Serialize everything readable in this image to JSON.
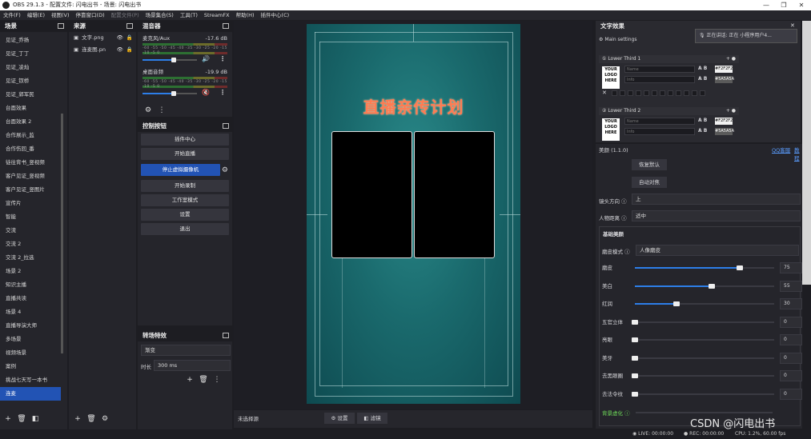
{
  "window": {
    "title": "OBS 29.1.3 - 配置文件: 闪电出书 - 场景: 闪电出书",
    "min": "—",
    "max": "❐",
    "close": "✕"
  },
  "menu": [
    "文件(F)",
    "编辑(E)",
    "视图(V)",
    "停靠窗口(D)",
    "配置文件(P)",
    "场景集合(S)",
    "工具(T)",
    "StreamFX",
    "帮助(H)",
    "插件中心(C)"
  ],
  "scenes": {
    "title": "场景",
    "items": [
      "见证_乔扬",
      "见证_丁丁",
      "见证_凌灿",
      "见证_钗桥",
      "见证_郭军民",
      "台面效果",
      "台面效果 2",
      "合作展示_监",
      "合作伤回_番",
      "徒往背书_竖视频",
      "客户见证_竖视频",
      "客户见证_竖图片",
      "宣传片",
      "智能",
      "交流",
      "交流 2",
      "交流 2_拉选",
      "场景 2",
      "知识主播",
      "直播共读",
      "场景 4",
      "直播导演大师",
      "多场景",
      "视频场景",
      "案例",
      "挑战七天写一本书",
      "连麦"
    ],
    "selected_index": 26
  },
  "sources": {
    "title": "来源",
    "items": [
      {
        "name": "文字.png",
        "icon": "image-icon"
      },
      {
        "name": "连麦图.pn",
        "icon": "image-icon"
      }
    ]
  },
  "mixer": {
    "title": "混音器",
    "channels": [
      {
        "name": "麦克风/Aux",
        "db": "-17.6 dB",
        "level": 0.3,
        "muted": false
      },
      {
        "name": "桌面音频",
        "db": "-19.9 dB",
        "level": 0.3,
        "muted": true
      }
    ],
    "ticks": "-60 -55 -50 -45 -40 -35 -30 -25 -20 -15 -10 -5 0"
  },
  "controls": {
    "title": "控制按钮",
    "buttons": [
      "插件中心",
      "开始直播",
      "停止虚拟摄像机",
      "开始录制",
      "工作室模式",
      "设置",
      "退出"
    ],
    "active_index": 2
  },
  "transitions": {
    "title": "转场特效",
    "type": "渐变",
    "duration_label": "时长",
    "duration": "300 ms"
  },
  "preview": {
    "overlay_title": "直播亲传计划",
    "bottom_label": "未选择源",
    "settings_btn": "设置",
    "filters_btn": "滤镜"
  },
  "text_effects": {
    "title": "文字效果",
    "main_settings": "Main settings",
    "lower_thirds": [
      {
        "label": "Lower Third 1",
        "name_ph": "Name",
        "info_ph": "Info",
        "color1": "#F2F2F2",
        "color2": "#5A5A5A"
      },
      {
        "label": "Lower Third 2",
        "name_ph": "Name",
        "info_ph": "Info",
        "color1": "#F2F2F2",
        "color2": "#5A5A5A"
      }
    ],
    "logo_text": "YOUR LOGO HERE"
  },
  "tooltip": {
    "speaking": "正在讲话:",
    "text": "正在 小程序用户4..."
  },
  "beauty": {
    "title": "美颜 (1.1.0)",
    "qq_link": "QQ客服",
    "about_link": "教程",
    "reset_btn": "恢复默认",
    "auto_btn": "自动对焦",
    "direction_label": "镜头方向",
    "direction_value": "上",
    "distance_label": "人物距离",
    "distance_value": "适中",
    "section": "基础美颜",
    "mode_label": "磨皮模式",
    "mode_value": "人像磨皮",
    "sliders": [
      {
        "label": "磨皮",
        "value": "75",
        "level": 0.75
      },
      {
        "label": "美白",
        "value": "55",
        "level": 0.55
      },
      {
        "label": "红润",
        "value": "30",
        "level": 0.3
      },
      {
        "label": "五官立体",
        "value": "0",
        "level": 0
      },
      {
        "label": "亮眼",
        "value": "0",
        "level": 0
      },
      {
        "label": "美牙",
        "value": "0",
        "level": 0
      },
      {
        "label": "去黑眼圈",
        "value": "0",
        "level": 0
      },
      {
        "label": "去法令纹",
        "value": "0",
        "level": 0
      }
    ],
    "bg_blur_label": "背景虚化"
  },
  "status": {
    "live": "LIVE: 00:00:00",
    "rec": "REC: 00:00:00",
    "cpu": "CPU: 1.2%, 60.00 fps"
  },
  "watermark": "CSDN @闪电出书"
}
